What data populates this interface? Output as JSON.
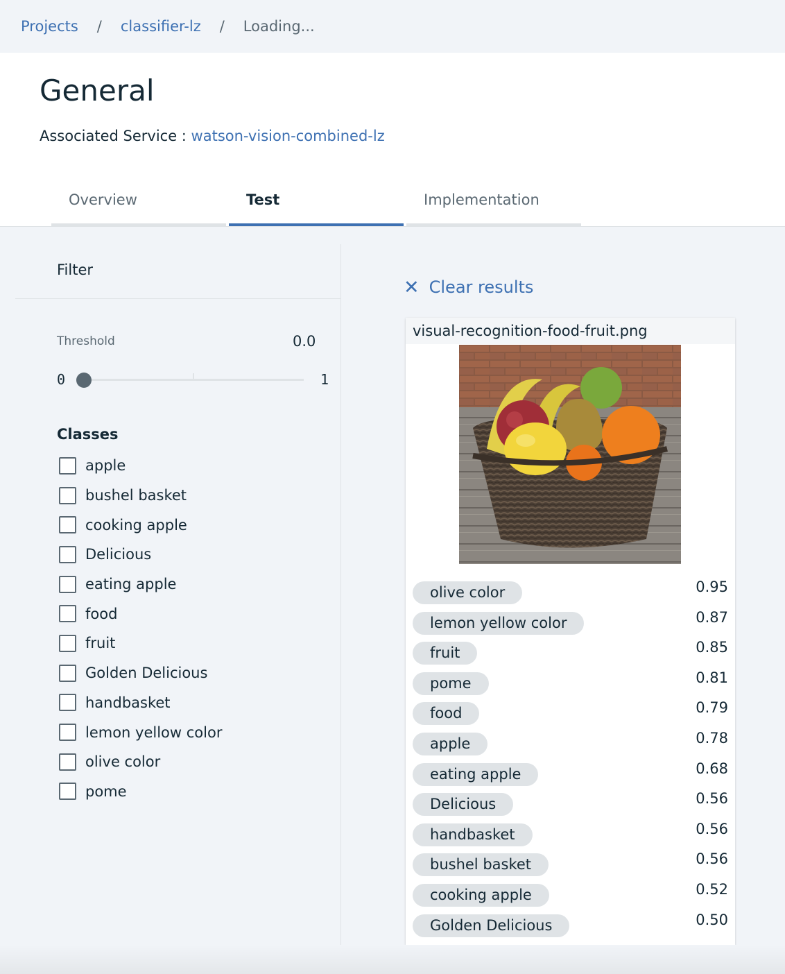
{
  "breadcrumb": {
    "items": [
      "Projects",
      "classifier-lz"
    ],
    "current": "Loading...",
    "separator": "/"
  },
  "header": {
    "title": "General",
    "service_label": "Associated Service : ",
    "service_link": "watson-vision-combined-lz"
  },
  "tabs": [
    {
      "label": "Overview",
      "active": false
    },
    {
      "label": "Test",
      "active": true
    },
    {
      "label": "Implementation",
      "active": false
    }
  ],
  "filter": {
    "title": "Filter",
    "threshold_label": "Threshold",
    "threshold_value": "0.0",
    "slider_min": "0",
    "slider_max": "1",
    "classes_title": "Classes",
    "classes": [
      "apple",
      "bushel basket",
      "cooking apple",
      "Delicious",
      "eating apple",
      "food",
      "fruit",
      "Golden Delicious",
      "handbasket",
      "lemon yellow color",
      "olive color",
      "pome"
    ]
  },
  "results": {
    "clear_icon": "close-icon",
    "clear_label": "Clear results",
    "filename": "visual-recognition-food-fruit.png",
    "items": [
      {
        "label": "olive color",
        "score": "0.95"
      },
      {
        "label": "lemon yellow color",
        "score": "0.87"
      },
      {
        "label": "fruit",
        "score": "0.85"
      },
      {
        "label": "pome",
        "score": "0.81"
      },
      {
        "label": "food",
        "score": "0.79"
      },
      {
        "label": "apple",
        "score": "0.78"
      },
      {
        "label": "eating apple",
        "score": "0.68"
      },
      {
        "label": "Delicious",
        "score": "0.56"
      },
      {
        "label": "handbasket",
        "score": "0.56"
      },
      {
        "label": "bushel basket",
        "score": "0.56"
      },
      {
        "label": "cooking apple",
        "score": "0.52"
      },
      {
        "label": "Golden Delicious",
        "score": "0.50"
      }
    ]
  },
  "colors": {
    "accent": "#3d70b2",
    "text": "#152935",
    "muted": "#5a6872",
    "background": "#f1f4f8",
    "tag_background": "#dfe3e6"
  }
}
